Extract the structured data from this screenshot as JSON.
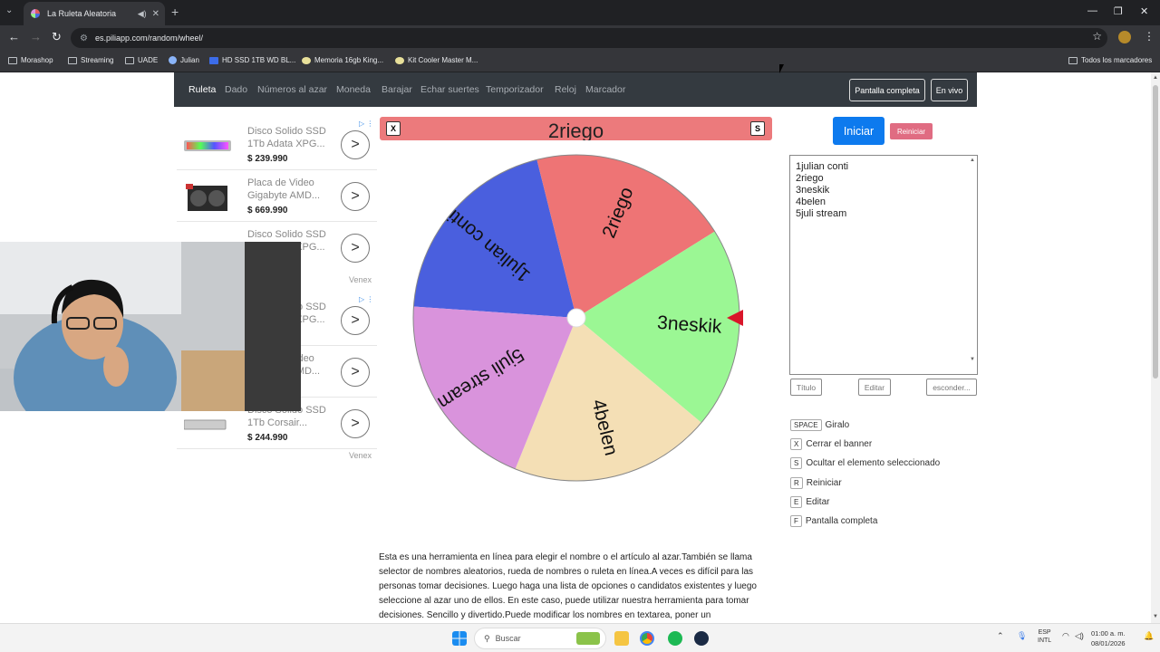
{
  "browser": {
    "tab_title": "La Ruleta Aleatoria",
    "url": "es.piliapp.com/random/wheel/",
    "bookmarks": [
      "Morashop",
      "Streaming",
      "UADE",
      "Julian",
      "HD SSD 1TB WD BL...",
      "Memoria 16gb King...",
      "Kit Cooler Master M..."
    ],
    "bookmarks_right": "Todos los marcadores"
  },
  "nav": {
    "items": [
      "Ruleta",
      "Dado",
      "Números al azar",
      "Moneda",
      "Barajar",
      "Echar suertes",
      "Temporizador",
      "Reloj",
      "Marcador"
    ],
    "fullscreen": "Pantalla completa",
    "live": "En vivo"
  },
  "ads": [
    {
      "title": "Disco Solido SSD 1Tb Adata XPG...",
      "price": "$ 239.990"
    },
    {
      "title": "Placa de Video Gigabyte AMD...",
      "price": "$ 669.990"
    },
    {
      "title": "Disco Solido SSD 1Tb Adata XPG...",
      "price": ""
    },
    {
      "title": "Disco Solido SSD 1Tb Adata XPG...",
      "price": ""
    },
    {
      "title": "Placa de Video Gigabyte AMD...",
      "price": ""
    },
    {
      "title": "Disco Solido SSD 1Tb Corsair...",
      "price": "$ 244.990"
    }
  ],
  "ad_brand": "Venex",
  "banner": {
    "text": "2riego",
    "close_key": "X",
    "hide_key": "S"
  },
  "wheel": {
    "segments": [
      {
        "label": "1julian conti",
        "color": "#4a5fde"
      },
      {
        "label": "2riego",
        "color": "#ee7475"
      },
      {
        "label": "3neskik",
        "color": "#9bf794"
      },
      {
        "label": "4belen",
        "color": "#f4dfb5"
      },
      {
        "label": "5juli stream",
        "color": "#d993dc"
      }
    ],
    "pointer_color": "#d9162a"
  },
  "controls": {
    "start": "Iniciar",
    "reset": "Reiniciar",
    "entries": [
      "1julian conti",
      "2riego",
      "3neskik",
      "4belen",
      "5juli stream"
    ],
    "title_btn": "Título",
    "edit_btn": "Editar",
    "hide_btn": "esconder..."
  },
  "shortcuts": [
    {
      "key": "SPACE",
      "label": "Giralo"
    },
    {
      "key": "X",
      "label": "Cerrar el banner"
    },
    {
      "key": "S",
      "label": "Ocultar el elemento seleccionado"
    },
    {
      "key": "R",
      "label": "Reiniciar"
    },
    {
      "key": "E",
      "label": "Editar"
    },
    {
      "key": "F",
      "label": "Pantalla completa"
    }
  ],
  "description": "Esta es una herramienta en línea para elegir el nombre o el artículo al azar.También se llama selector de nombres aleatorios, rueda de nombres o ruleta en línea.A veces es difícil para las personas tomar decisiones. Luego haga una lista de opciones o candidatos existentes y luego seleccione al azar uno de ellos. En este caso, puede utilizar nuestra herramienta para tomar decisiones. Sencillo y divertido.Puede modificar los nombres en textarea, poner un",
  "taskbar": {
    "search": "Buscar",
    "lang": "ESP",
    "lang2": "INTL",
    "time": "01:00 a. m.",
    "date": "08/01/2026"
  }
}
